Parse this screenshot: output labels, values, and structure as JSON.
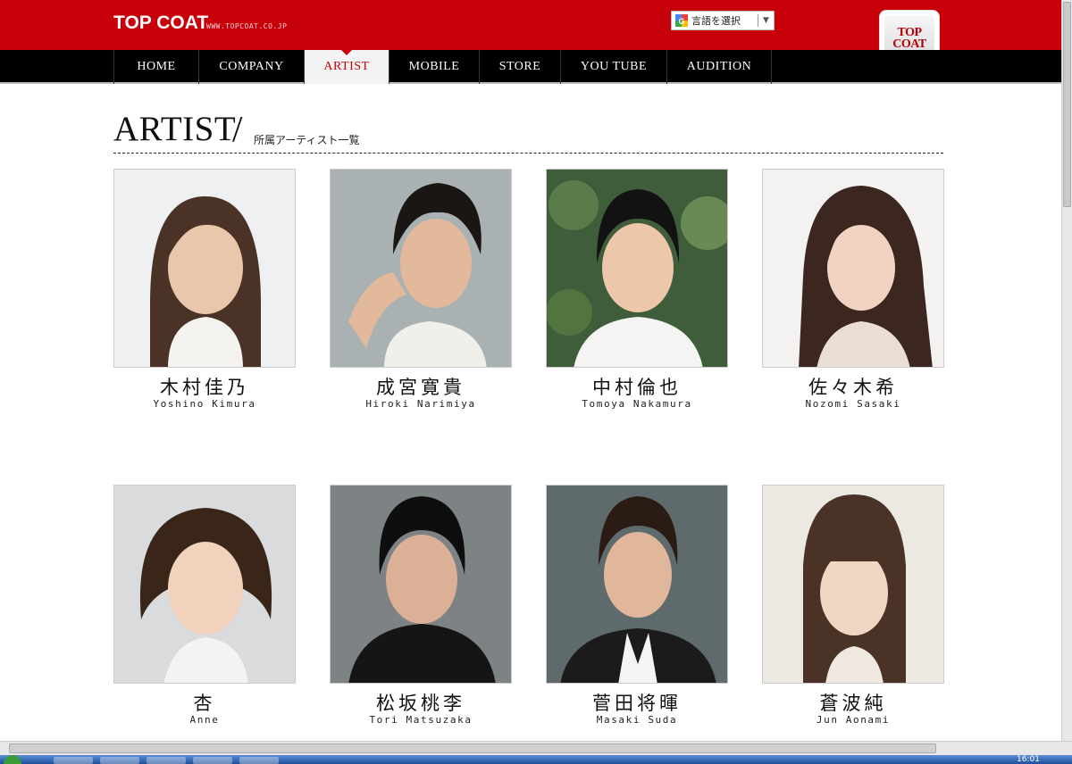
{
  "header": {
    "brand": "TOP COAT",
    "brand_url": "WWW.TOPCOAT.CO.JP",
    "language_selector": "言語を選択",
    "logo_line1": "TOP",
    "logo_line2": "COAT"
  },
  "nav": {
    "items": [
      {
        "label": "HOME",
        "active": false
      },
      {
        "label": "COMPANY",
        "active": false
      },
      {
        "label": "ARTIST",
        "active": true
      },
      {
        "label": "MOBILE",
        "active": false
      },
      {
        "label": "STORE",
        "active": false
      },
      {
        "label": "YOU TUBE",
        "active": false
      },
      {
        "label": "AUDITION",
        "active": false
      }
    ]
  },
  "page": {
    "title": "ARTIST",
    "slash": "/",
    "subtitle": "所属アーティスト一覧"
  },
  "artists": [
    {
      "jp": "木村佳乃",
      "en": "Yoshino Kimura"
    },
    {
      "jp": "成宮寛貴",
      "en": "Hiroki Narimiya"
    },
    {
      "jp": "中村倫也",
      "en": "Tomoya Nakamura"
    },
    {
      "jp": "佐々木希",
      "en": "Nozomi Sasaki"
    },
    {
      "jp": "杏",
      "en": "Anne"
    },
    {
      "jp": "松坂桃李",
      "en": "Tori Matsuzaka"
    },
    {
      "jp": "菅田将暉",
      "en": "Masaki Suda"
    },
    {
      "jp": "蒼波純",
      "en": "Jun Aonami"
    }
  ],
  "taskbar": {
    "clock": "16:01"
  },
  "colors": {
    "brand_red": "#c8000a",
    "nav_black": "#000000",
    "active_bg": "#f3f3f3"
  }
}
